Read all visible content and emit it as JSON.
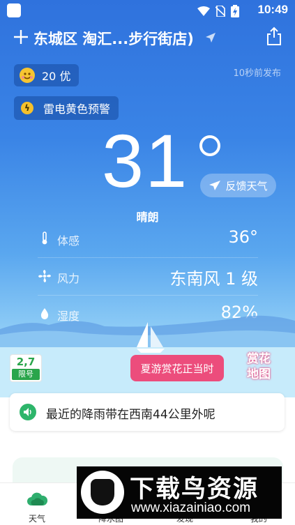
{
  "status_bar": {
    "time": "10:49"
  },
  "header": {
    "location": "东城区 淘汇...步行街店)"
  },
  "aqi": {
    "label": "20 优"
  },
  "publish_time": "10秒前发布",
  "alert": {
    "label": "雷电黄色预警"
  },
  "weather": {
    "temperature": "31",
    "condition": "晴朗",
    "feedback_label": "反馈天气"
  },
  "metrics": [
    {
      "label": "体感",
      "value": "36°",
      "icon": "thermometer-icon"
    },
    {
      "label": "风力",
      "value": "东南风 1 级",
      "icon": "fan-icon"
    },
    {
      "label": "湿度",
      "value": "82%",
      "icon": "droplet-icon"
    }
  ],
  "traffic_limit": {
    "numbers": "2,7",
    "tag": "限号"
  },
  "promo": {
    "label": "夏游赏花正当时",
    "badge_line1": "赏花",
    "badge_line2": "地图"
  },
  "rain_notice": {
    "text": "最近的降雨带在西南44公里外呢"
  },
  "tabs": [
    {
      "label": "天气",
      "icon": "cloud-icon"
    },
    {
      "label": "降水图",
      "icon": "rain-map-icon"
    },
    {
      "label": "发现",
      "icon": "discover-icon"
    },
    {
      "label": "我的",
      "icon": "profile-icon"
    }
  ],
  "watermark": {
    "title": "下载鸟资源",
    "url": "www.xiazainiao.com"
  },
  "colors": {
    "sky_top": "#2f72dd",
    "promo_pink": "#ec4d7c",
    "plate_green": "#2aa54b",
    "rain_green": "#2db56a"
  }
}
